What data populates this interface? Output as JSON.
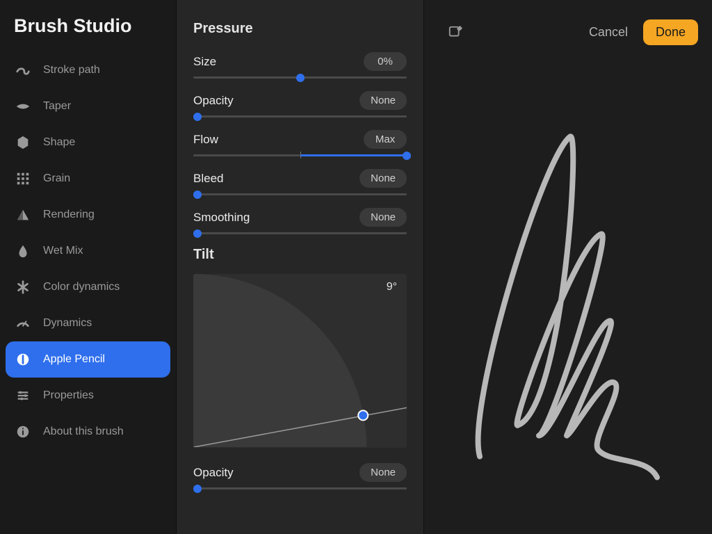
{
  "app": {
    "title": "Brush Studio"
  },
  "sidebar": {
    "items": [
      {
        "label": "Stroke path",
        "icon": "stroke-path-icon"
      },
      {
        "label": "Taper",
        "icon": "taper-icon"
      },
      {
        "label": "Shape",
        "icon": "shape-icon"
      },
      {
        "label": "Grain",
        "icon": "grain-icon"
      },
      {
        "label": "Rendering",
        "icon": "rendering-icon"
      },
      {
        "label": "Wet Mix",
        "icon": "wetmix-icon"
      },
      {
        "label": "Color dynamics",
        "icon": "color-dynamics-icon"
      },
      {
        "label": "Dynamics",
        "icon": "dynamics-icon"
      },
      {
        "label": "Apple Pencil",
        "icon": "apple-pencil-icon",
        "selected": true
      },
      {
        "label": "Properties",
        "icon": "properties-icon"
      },
      {
        "label": "About this brush",
        "icon": "about-icon"
      }
    ]
  },
  "settings": {
    "pressure": {
      "title": "Pressure",
      "sliders": [
        {
          "label": "Size",
          "pill": "0%",
          "value": 0.5,
          "midTick": true,
          "fill": false
        },
        {
          "label": "Opacity",
          "pill": "None",
          "value": 0.02,
          "fill": true
        },
        {
          "label": "Flow",
          "pill": "Max",
          "value": 1.0,
          "fill": true,
          "fillStart": 0.5,
          "midTick": true
        },
        {
          "label": "Bleed",
          "pill": "None",
          "value": 0.02,
          "fill": true
        },
        {
          "label": "Smoothing",
          "pill": "None",
          "value": 0.02,
          "fill": true
        }
      ]
    },
    "tilt": {
      "title": "Tilt",
      "angle": "9°",
      "sliders": [
        {
          "label": "Opacity",
          "pill": "None",
          "value": 0.02,
          "fill": true
        }
      ]
    }
  },
  "preview": {
    "cancel": "Cancel",
    "done": "Done"
  },
  "colors": {
    "accent": "#2f6fed",
    "done": "#f5a623"
  }
}
